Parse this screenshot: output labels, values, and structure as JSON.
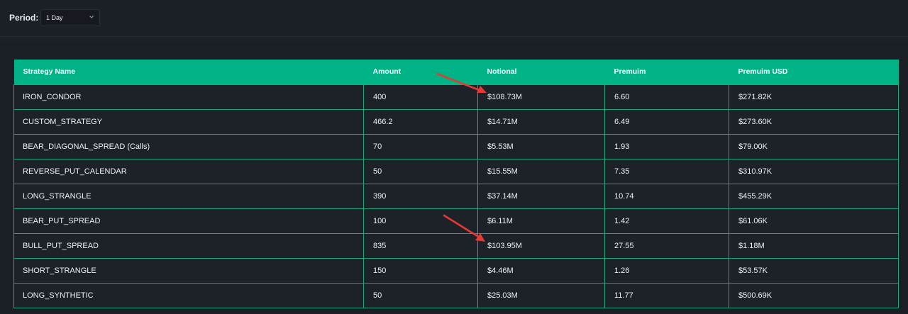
{
  "filter": {
    "label": "Period:",
    "selected": "1 Day"
  },
  "table": {
    "columns": [
      "Strategy Name",
      "Amount",
      "Notional",
      "Premuim",
      "Premuim USD"
    ],
    "rows": [
      [
        "IRON_CONDOR",
        "400",
        "$108.73M",
        "6.60",
        "$271.82K"
      ],
      [
        "CUSTOM_STRATEGY",
        "466.2",
        "$14.71M",
        "6.49",
        "$273.60K"
      ],
      [
        "BEAR_DIAGONAL_SPREAD (Calls)",
        "70",
        "$5.53M",
        "1.93",
        "$79.00K"
      ],
      [
        "REVERSE_PUT_CALENDAR",
        "50",
        "$15.55M",
        "7.35",
        "$310.97K"
      ],
      [
        "LONG_STRANGLE",
        "390",
        "$37.14M",
        "10.74",
        "$455.29K"
      ],
      [
        "BEAR_PUT_SPREAD",
        "100",
        "$6.11M",
        "1.42",
        "$61.06K"
      ],
      [
        "BULL_PUT_SPREAD",
        "835",
        "$103.95M",
        "27.55",
        "$1.18M"
      ],
      [
        "SHORT_STRANGLE",
        "150",
        "$4.46M",
        "1.26",
        "$53.57K"
      ],
      [
        "LONG_SYNTHETIC",
        "50",
        "$25.03M",
        "11.77",
        "$500.69K"
      ]
    ]
  },
  "colors": {
    "header": "#00b386",
    "annotation_arrow": "#e53935",
    "background": "#1c2027"
  },
  "annotations": [
    "arrow pointing at IRON_CONDOR notional",
    "arrow pointing at BULL_PUT_SPREAD notional"
  ]
}
